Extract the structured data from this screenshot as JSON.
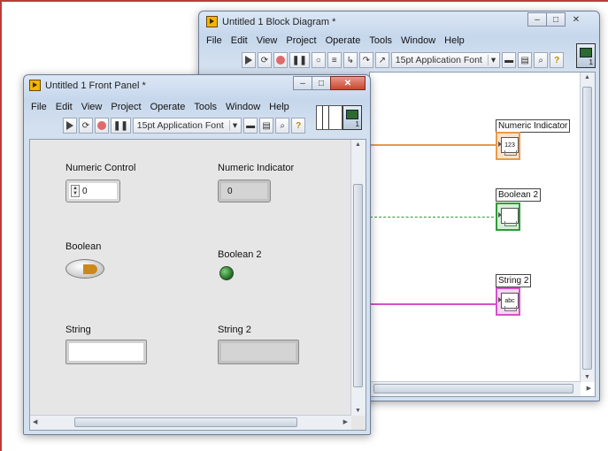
{
  "block_diagram": {
    "title": "Untitled 1 Block Diagram *",
    "menu": [
      "File",
      "Edit",
      "View",
      "Project",
      "Operate",
      "Tools",
      "Window",
      "Help"
    ],
    "font": "15pt Application Font",
    "terminals": [
      {
        "label": "Numeric Indicator",
        "face": "123",
        "color": "#e99a4a"
      },
      {
        "label": "Boolean 2",
        "face": "",
        "color": "#2f9a3a"
      },
      {
        "label": "String 2",
        "face": "abc",
        "color": "#d452c8"
      }
    ]
  },
  "front_panel": {
    "title": "Untitled 1 Front Panel *",
    "menu": [
      "File",
      "Edit",
      "View",
      "Project",
      "Operate",
      "Tools",
      "Window",
      "Help"
    ],
    "font": "15pt Application Font",
    "controls": {
      "numeric_control": {
        "label": "Numeric Control",
        "value": "0"
      },
      "numeric_indicator": {
        "label": "Numeric Indicator",
        "value": "0"
      },
      "boolean": {
        "label": "Boolean"
      },
      "boolean2": {
        "label": "Boolean 2"
      },
      "string": {
        "label": "String",
        "value": ""
      },
      "string2": {
        "label": "String 2",
        "value": ""
      }
    }
  },
  "icons": {
    "run": "run-arrow-icon",
    "run_continuous": "run-continuously-icon",
    "abort": "abort-icon",
    "pause": "pause-icon",
    "help": "context-help-icon"
  }
}
